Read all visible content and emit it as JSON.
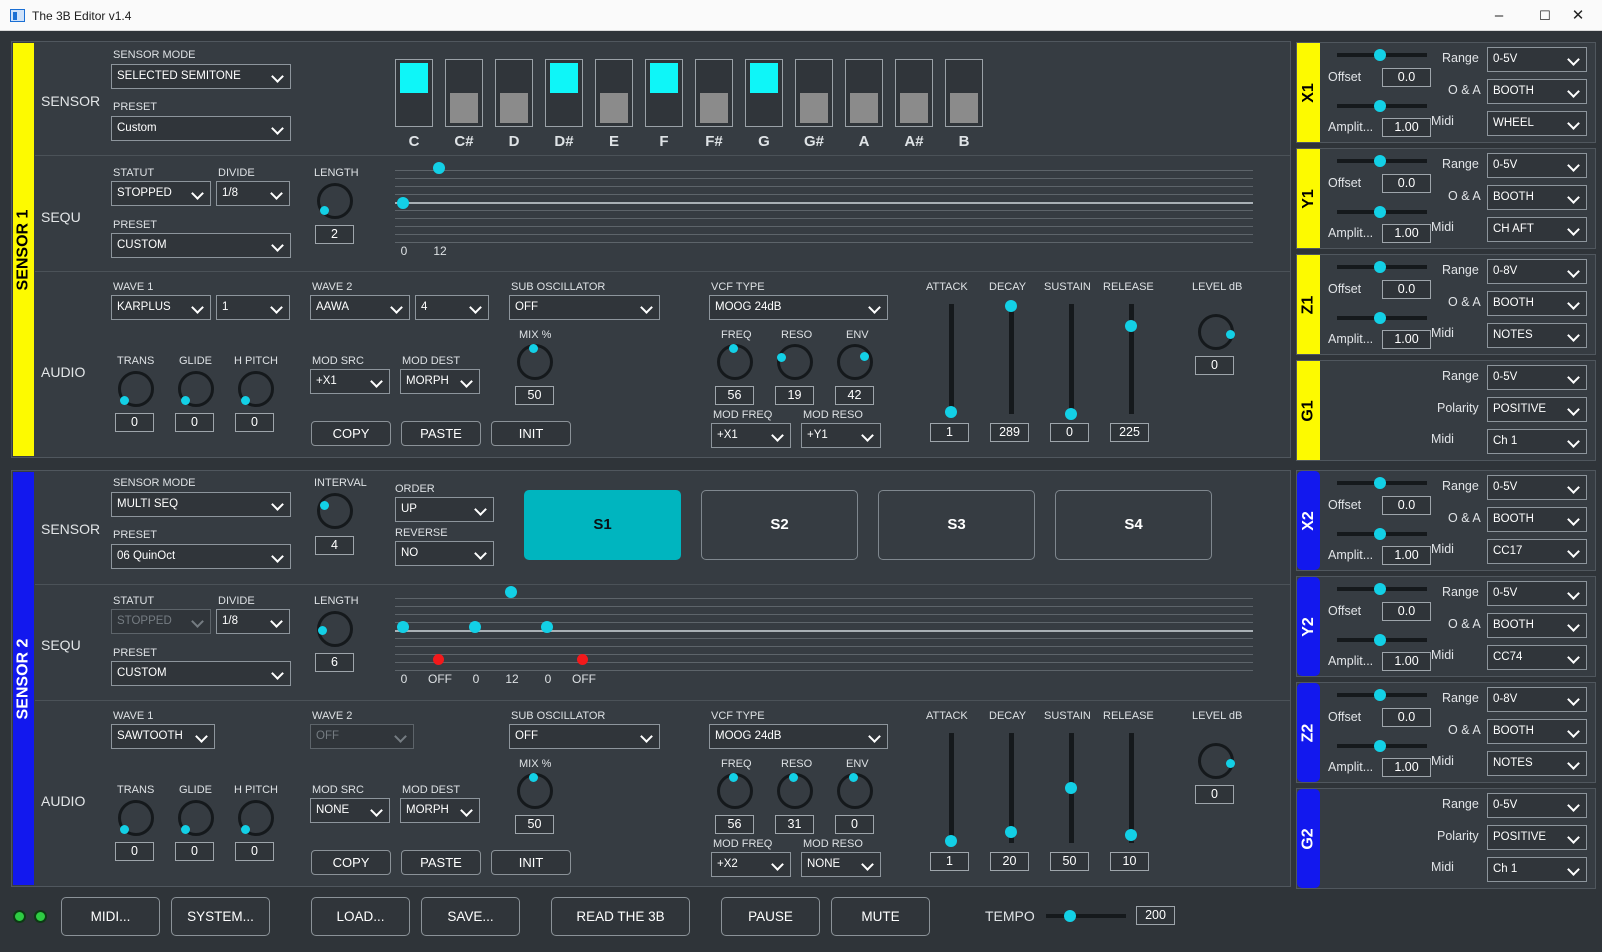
{
  "window": {
    "title": "The 3B Editor v1.4",
    "min": "–",
    "max": "☐",
    "close": "✕"
  },
  "colors": {
    "sensor1": "#fdfa00",
    "sensor2": "#1218ee",
    "accent": "#13d0e6"
  },
  "s1": {
    "bar": "SENSOR 1",
    "sensor": {
      "label": "SENSOR",
      "mode_label": "SENSOR MODE",
      "mode": "SELECTED SEMITONE",
      "preset_label": "PRESET",
      "preset": "Custom"
    },
    "notes": [
      {
        "n": "C",
        "on": true
      },
      {
        "n": "C#",
        "on": false
      },
      {
        "n": "D",
        "on": false
      },
      {
        "n": "D#",
        "on": true
      },
      {
        "n": "E",
        "on": false
      },
      {
        "n": "F",
        "on": true
      },
      {
        "n": "F#",
        "on": false
      },
      {
        "n": "G",
        "on": true
      },
      {
        "n": "G#",
        "on": false
      },
      {
        "n": "A",
        "on": false
      },
      {
        "n": "A#",
        "on": false
      },
      {
        "n": "B",
        "on": false
      }
    ],
    "sequ": {
      "label": "SEQU",
      "statut_label": "STATUT",
      "statut": "STOPPED",
      "divide_label": "DIVIDE",
      "divide": "1/8",
      "preset_label": "PRESET",
      "preset": "CUSTOM",
      "length_label": "LENGTH",
      "length": "2",
      "steps": [
        "0",
        "12"
      ]
    },
    "audio": {
      "label": "AUDIO",
      "wave1_label": "WAVE 1",
      "wave1": "KARPLUS",
      "wave1_b": "1",
      "wave2_label": "WAVE 2",
      "wave2": "AAWA",
      "wave2_b": "4",
      "sub_label": "SUB OSCILLATOR",
      "sub": "OFF",
      "vcf_label": "VCF TYPE",
      "vcf": "MOOG 24dB",
      "trans_label": "TRANS",
      "trans": "0",
      "glide_label": "GLIDE",
      "glide": "0",
      "hpitch_label": "H PITCH",
      "hpitch": "0",
      "modsrc_label": "MOD SRC",
      "modsrc": "+X1",
      "moddest_label": "MOD DEST",
      "moddest": "MORPH",
      "mix_label": "MIX %",
      "mix": "50",
      "freq_label": "FREQ",
      "freq": "56",
      "reso_label": "RESO",
      "reso": "19",
      "env_label": "ENV",
      "env": "42",
      "modfreq_label": "MOD FREQ",
      "modfreq": "+X1",
      "modreso_label": "MOD RESO",
      "modreso": "+Y1",
      "copy": "COPY",
      "paste": "PASTE",
      "init": "INIT",
      "attack_label": "ATTACK",
      "attack": "1",
      "decay_label": "DECAY",
      "decay": "289",
      "sustain_label": "SUSTAIN",
      "sustain": "0",
      "release_label": "RELEASE",
      "release": "225",
      "level_label": "LEVEL dB",
      "level": "0"
    }
  },
  "s2": {
    "bar": "SENSOR 2",
    "sensor": {
      "label": "SENSOR",
      "mode_label": "SENSOR MODE",
      "mode": "MULTI SEQ",
      "preset_label": "PRESET",
      "preset": "06 QuinOct",
      "interval_label": "INTERVAL",
      "interval": "4",
      "order_label": "ORDER",
      "order": "UP",
      "reverse_label": "REVERSE",
      "reverse": "NO",
      "pads": [
        "S1",
        "S2",
        "S3",
        "S4"
      ]
    },
    "sequ": {
      "label": "SEQU",
      "statut_label": "STATUT",
      "statut": "STOPPED",
      "divide_label": "DIVIDE",
      "divide": "1/8",
      "preset_label": "PRESET",
      "preset": "CUSTOM",
      "length_label": "LENGTH",
      "length": "6",
      "steps": [
        "0",
        "OFF",
        "0",
        "12",
        "0",
        "OFF"
      ]
    },
    "audio": {
      "label": "AUDIO",
      "wave1_label": "WAVE 1",
      "wave1": "SAWTOOTH",
      "wave2_label": "WAVE 2",
      "wave2": "OFF",
      "sub_label": "SUB OSCILLATOR",
      "sub": "OFF",
      "vcf_label": "VCF TYPE",
      "vcf": "MOOG 24dB",
      "trans_label": "TRANS",
      "trans": "0",
      "glide_label": "GLIDE",
      "glide": "0",
      "hpitch_label": "H PITCH",
      "hpitch": "0",
      "modsrc_label": "MOD SRC",
      "modsrc": "NONE",
      "moddest_label": "MOD DEST",
      "moddest": "MORPH",
      "mix_label": "MIX %",
      "mix": "50",
      "freq_label": "FREQ",
      "freq": "56",
      "reso_label": "RESO",
      "reso": "31",
      "env_label": "ENV",
      "env": "0",
      "modfreq_label": "MOD FREQ",
      "modfreq": "+X2",
      "modreso_label": "MOD RESO",
      "modreso": "NONE",
      "copy": "COPY",
      "paste": "PASTE",
      "init": "INIT",
      "attack_label": "ATTACK",
      "attack": "1",
      "decay_label": "DECAY",
      "decay": "20",
      "sustain_label": "SUSTAIN",
      "sustain": "50",
      "release_label": "RELEASE",
      "release": "10",
      "level_label": "LEVEL dB",
      "level": "0"
    }
  },
  "right": {
    "range_label": "Range",
    "offset_label": "Offset",
    "oa_label": "O & A",
    "amp_label": "Amplit...",
    "midi_label": "Midi",
    "polarity_label": "Polarity",
    "x1": {
      "tag": "X1",
      "range": "0-5V",
      "offset": "0.0",
      "oa": "BOOTH",
      "amp": "1.00",
      "midi": "WHEEL"
    },
    "y1": {
      "tag": "Y1",
      "range": "0-5V",
      "offset": "0.0",
      "oa": "BOOTH",
      "amp": "1.00",
      "midi": "CH AFT"
    },
    "z1": {
      "tag": "Z1",
      "range": "0-8V",
      "offset": "0.0",
      "oa": "BOOTH",
      "amp": "1.00",
      "midi": "NOTES"
    },
    "g1": {
      "tag": "G1",
      "range": "0-5V",
      "polarity": "POSITIVE",
      "midi": "Ch 1"
    },
    "x2": {
      "tag": "X2",
      "range": "0-5V",
      "offset": "0.0",
      "oa": "BOOTH",
      "amp": "1.00",
      "midi": "CC17"
    },
    "y2": {
      "tag": "Y2",
      "range": "0-5V",
      "offset": "0.0",
      "oa": "BOOTH",
      "amp": "1.00",
      "midi": "CC74"
    },
    "z2": {
      "tag": "Z2",
      "range": "0-8V",
      "offset": "0.0",
      "oa": "BOOTH",
      "amp": "1.00",
      "midi": "NOTES"
    },
    "g2": {
      "tag": "G2",
      "range": "0-5V",
      "polarity": "POSITIVE",
      "midi": "Ch 1"
    }
  },
  "bottom": {
    "midi": "MIDI...",
    "system": "SYSTEM...",
    "load": "LOAD...",
    "save": "SAVE...",
    "read": "READ THE 3B",
    "pause": "PAUSE",
    "mute": "MUTE",
    "tempo_label": "TEMPO",
    "tempo": "200"
  }
}
